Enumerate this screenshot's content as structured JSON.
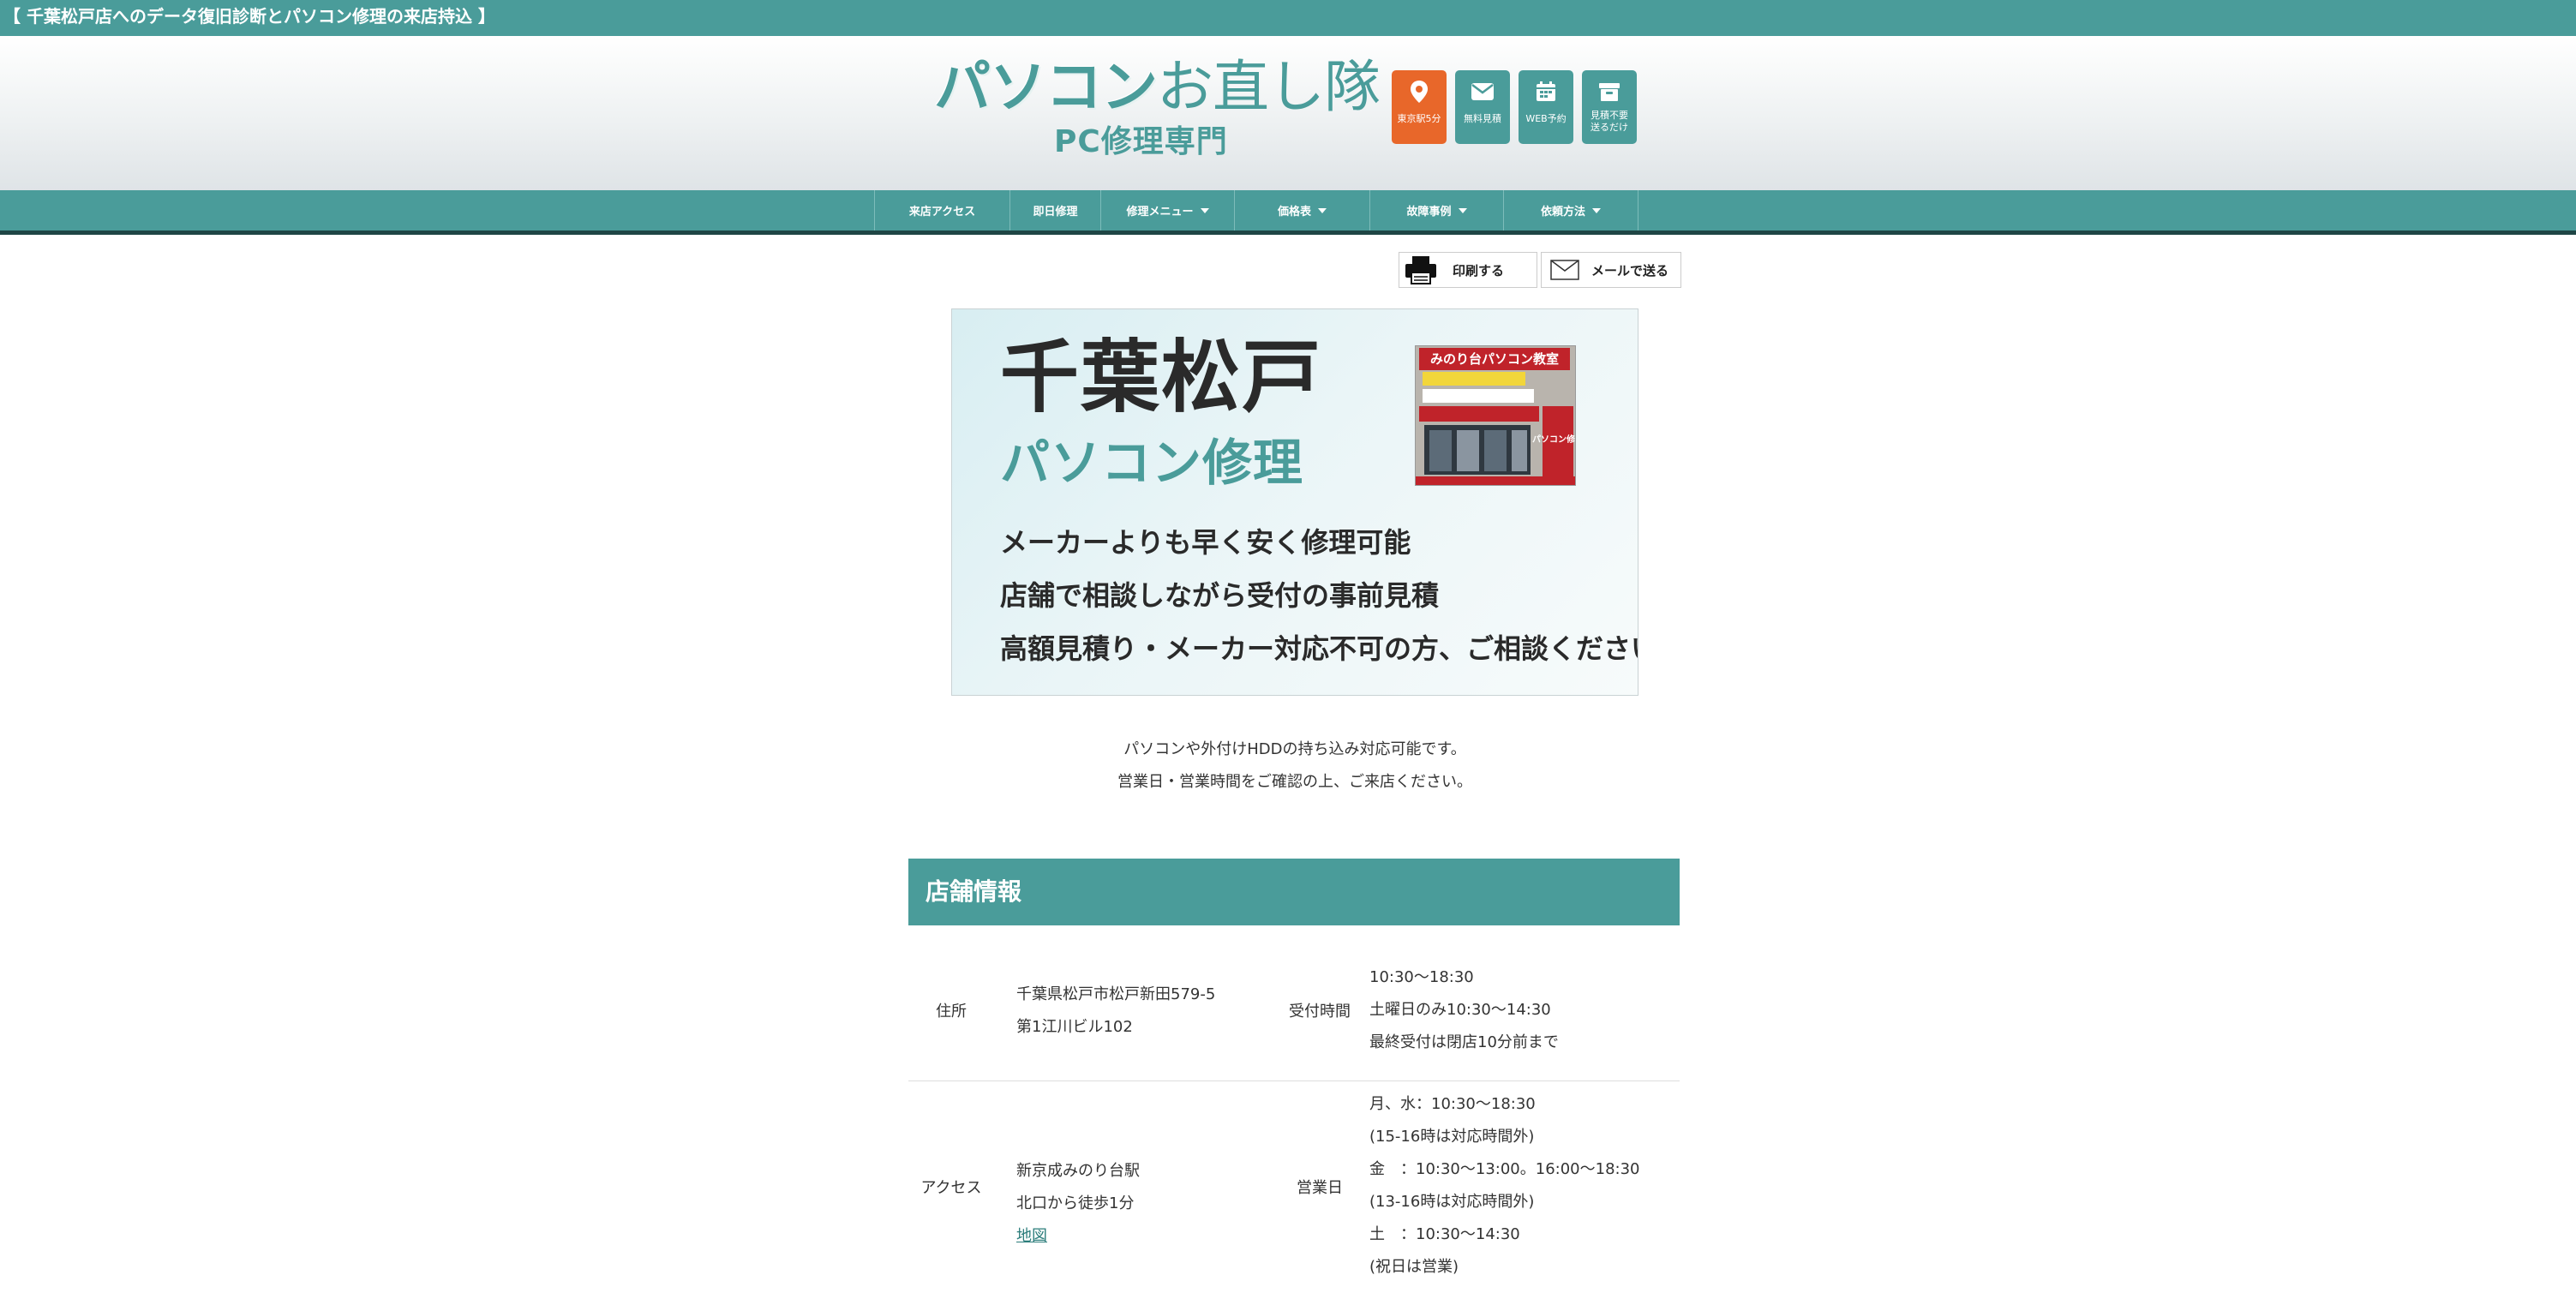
{
  "top_bar": {
    "title": "【 千葉松戸店へのデータ復旧診断とパソコン修理の来店持込 】"
  },
  "logo": {
    "main_strong": "パソコン",
    "main_light": "お直し隊",
    "sub": "PC修理専門"
  },
  "quick_buttons": [
    {
      "label_1": "東京駅5分",
      "label_2": "",
      "icon": "map-pin-icon",
      "color": "#e8672a"
    },
    {
      "label_1": "無料見積",
      "label_2": "",
      "icon": "envelope-icon",
      "color": "#4a9c9a"
    },
    {
      "label_1": "WEB予約",
      "label_2": "",
      "icon": "calendar-icon",
      "color": "#4a9c9a"
    },
    {
      "label_1": "見積不要",
      "label_2": "送るだけ",
      "icon": "box-icon",
      "color": "#4a9c9a"
    }
  ],
  "nav": [
    {
      "label": "来店アクセス",
      "dropdown": false
    },
    {
      "label": "即日修理",
      "dropdown": false
    },
    {
      "label": "修理メニュー",
      "dropdown": true
    },
    {
      "label": "価格表",
      "dropdown": true
    },
    {
      "label": "故障事例",
      "dropdown": true
    },
    {
      "label": "依頼方法",
      "dropdown": true
    }
  ],
  "tools": {
    "print": "印刷する",
    "mail": "メールで送る"
  },
  "banner": {
    "title_1": "千葉松戸",
    "title_2": "パソコン修理",
    "lines": [
      "メーカーよりも早く安く修理可能",
      "店舗で相談しながら受付の事前見積",
      "高額見積り・メーカー対応不可の方、ご相談ください"
    ],
    "photo_sign_1": "みのり台パソコン教室",
    "photo_sign_2": "パソコン修理"
  },
  "intro": {
    "line_1": "パソコンや外付けHDDの持ち込み対応可能です。",
    "line_2": "営業日・営業時間をご確認の上、ご来店ください。"
  },
  "store_info": {
    "heading": "店舗情報",
    "rows": [
      {
        "key_left": "住所",
        "val_left": [
          "千葉県松戸市松戸新田579-5",
          "第1江川ビル102"
        ],
        "key_right": "受付時間",
        "val_right": [
          "10:30〜18:30",
          "土曜日のみ10:30〜14:30",
          "最終受付は閉店10分前まで"
        ]
      },
      {
        "key_left": "アクセス",
        "val_left": [
          "新京成みのり台駅",
          "北口から徒歩1分"
        ],
        "link": "地図",
        "key_right": "営業日",
        "val_right": [
          "月、水：10:30〜18:30",
          "(15-16時は対応時間外)",
          "金　：10:30〜13:00。16:00〜18:30",
          "(13-16時は対応時間外)",
          "土　：10:30〜14:30",
          "(祝日は営業)"
        ]
      }
    ]
  },
  "colors": {
    "brand_teal": "#4a9c9a",
    "accent_orange": "#e8672a",
    "nav_border": "#1f4645"
  }
}
